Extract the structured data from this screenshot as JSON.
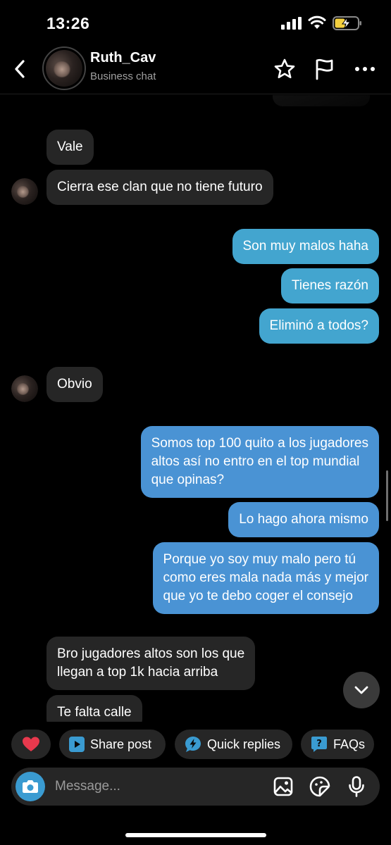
{
  "status_bar": {
    "time": "13:26"
  },
  "header": {
    "name": "Ruth_Cav",
    "subtitle": "Business chat",
    "icons": [
      "back-chevron-icon",
      "star-icon",
      "flag-icon",
      "more-dots-icon"
    ]
  },
  "messages": [
    {
      "direction": "in",
      "text": "Vale"
    },
    {
      "direction": "in",
      "text": "Cierra ese clan que no tiene futuro"
    },
    {
      "direction": "out",
      "text": "Son muy malos haha"
    },
    {
      "direction": "out",
      "text": "Tienes razón"
    },
    {
      "direction": "out",
      "text": "Eliminó a todos?"
    },
    {
      "direction": "in",
      "text": "Obvio"
    },
    {
      "direction": "out",
      "lines": [
        "Somos top 100 quito a los jugadores",
        "altos así no entro en el top mundial",
        "que opinas?"
      ]
    },
    {
      "direction": "out",
      "text": "Lo hago ahora mismo"
    },
    {
      "direction": "out",
      "lines": [
        "Porque yo soy muy malo pero tú",
        "como eres mala nada más y mejor",
        "que yo te debo coger el consejo"
      ]
    },
    {
      "direction": "in",
      "lines": [
        "Bro jugadores altos son los que",
        "llegan a top 1k hacia arriba"
      ]
    },
    {
      "direction": "in",
      "text": "Te falta calle"
    }
  ],
  "quick_actions": {
    "share_post": "Share post",
    "quick_replies": "Quick replies",
    "faqs": "FAQs"
  },
  "composer": {
    "placeholder": "Message..."
  },
  "colors": {
    "background": "#000000",
    "incoming_bubble": "#262626",
    "outgoing_bubble_top": "#43a5cf",
    "outgoing_bubble_bottom": "#4a93d4",
    "heart": "#e8394d",
    "accent": "#3a9bd1"
  }
}
